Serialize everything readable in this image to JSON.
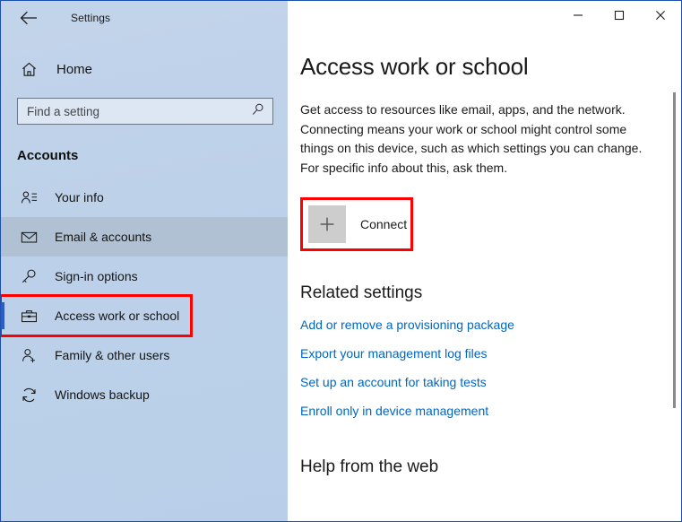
{
  "window": {
    "accent_color": "#1d4fb0",
    "titlebar": {
      "back_label": "back-arrow",
      "app_title": "Settings",
      "minimize_label": "Minimize",
      "maximize_label": "Maximize",
      "close_label": "Close"
    }
  },
  "sidebar": {
    "home": {
      "label": "Home",
      "icon": "home-icon"
    },
    "search": {
      "placeholder": "Find a setting",
      "value": "",
      "icon": "search-icon"
    },
    "category_heading": "Accounts",
    "items": [
      {
        "label": "Your info",
        "icon": "user-info-icon",
        "state": "normal"
      },
      {
        "label": "Email & accounts",
        "icon": "envelope-icon",
        "state": "hovered"
      },
      {
        "label": "Sign-in options",
        "icon": "key-icon",
        "state": "normal"
      },
      {
        "label": "Access work or school",
        "icon": "briefcase-icon",
        "state": "selected"
      },
      {
        "label": "Family & other users",
        "icon": "user-add-icon",
        "state": "normal"
      },
      {
        "label": "Windows backup",
        "icon": "sync-icon",
        "state": "normal"
      }
    ]
  },
  "main": {
    "title": "Access work or school",
    "description": "Get access to resources like email, apps, and the network. Connecting means your work or school might control some things on this device, such as which settings you can change. For specific info about this, ask them.",
    "connect_button": {
      "label": "Connect",
      "icon": "plus-icon",
      "highlight_color": "#ff0000"
    },
    "related_heading": "Related settings",
    "related_links": [
      "Add or remove a provisioning package",
      "Export your management log files",
      "Set up an account for taking tests",
      "Enroll only in device management"
    ],
    "link_color": "#0067c0",
    "help_heading": "Help from the web"
  }
}
